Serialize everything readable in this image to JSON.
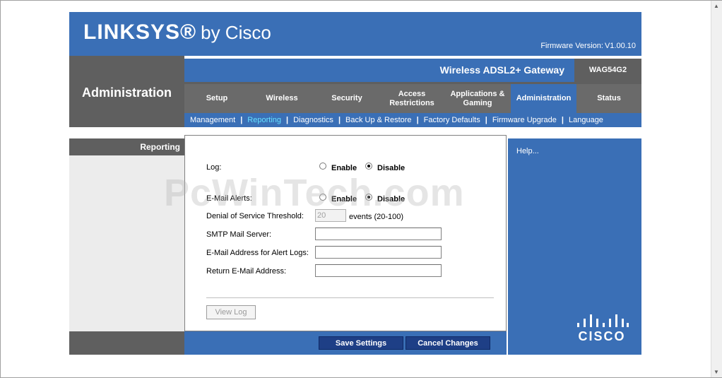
{
  "brand": {
    "logo": "LINKSYS®",
    "by": "by Cisco"
  },
  "header": {
    "firmware_label": "Firmware Version:",
    "firmware_value": "V1.00.10"
  },
  "section": {
    "title": "Administration"
  },
  "product": {
    "name": "Wireless ADSL2+ Gateway",
    "model": "WAG54G2"
  },
  "tabs": [
    {
      "label": "Setup",
      "active": false
    },
    {
      "label": "Wireless",
      "active": false
    },
    {
      "label": "Security",
      "active": false
    },
    {
      "label": "Access Restrictions",
      "active": false
    },
    {
      "label": "Applications & Gaming",
      "active": false
    },
    {
      "label": "Administration",
      "active": true
    },
    {
      "label": "Status",
      "active": false
    }
  ],
  "subtabs": [
    {
      "label": "Management",
      "active": false
    },
    {
      "label": "Reporting",
      "active": true
    },
    {
      "label": "Diagnostics",
      "active": false
    },
    {
      "label": "Back Up & Restore",
      "active": false
    },
    {
      "label": "Factory Defaults",
      "active": false
    },
    {
      "label": "Firmware Upgrade",
      "active": false
    },
    {
      "label": "Language",
      "active": false
    }
  ],
  "left": {
    "section_label": "Reporting"
  },
  "form": {
    "log_label": "Log:",
    "log_enable": "Enable",
    "log_disable": "Disable",
    "log_value": "disable",
    "email_alerts_label": "E-Mail Alerts:",
    "email_enable": "Enable",
    "email_disable": "Disable",
    "email_value": "disable",
    "dos_label": "Denial of Service Threshold:",
    "dos_value": "20",
    "dos_unit": "events (20-100)",
    "smtp_label": "SMTP Mail Server:",
    "smtp_value": "",
    "alert_email_label": "E-Mail Address for Alert Logs:",
    "alert_email_value": "",
    "return_email_label": "Return E-Mail Address:",
    "return_email_value": "",
    "view_log": "View Log"
  },
  "help": {
    "label": "Help..."
  },
  "actions": {
    "save": "Save Settings",
    "cancel": "Cancel Changes"
  },
  "watermark": "PcWinTech.com",
  "footer_logo": {
    "text": "CISCO"
  },
  "colors": {
    "linksys_blue": "#3a6fb6",
    "gray": "#5f5f5f",
    "active_subtab": "#66e0ff",
    "button_navy": "#1e3f86"
  },
  "icons": {
    "scroll_up": "triangle-up-icon",
    "scroll_down": "triangle-down-icon",
    "cisco_logo": "cisco-bridge-icon"
  }
}
